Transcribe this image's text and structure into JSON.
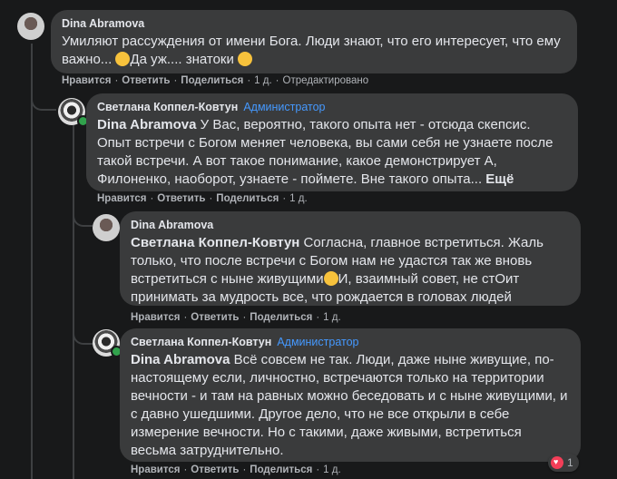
{
  "comments": [
    {
      "author": "Dina Abramova",
      "badge": "",
      "mention": "",
      "text": "Умиляют рассуждения от имени Бога. Люди знают, что его интересует, что ему важно...",
      "text2": "Да уж.... знатоки",
      "more": "",
      "actions": {
        "like": "Нравится",
        "reply": "Ответить",
        "share": "Поделиться",
        "time": "1 д.",
        "edited": "Отредактировано"
      }
    },
    {
      "author": "Светлана Коппел-Ковтун",
      "badge": "Администратор",
      "mention": "Dina Abramova",
      "text": " У Вас, вероятно, такого опыта нет - отсюда скепсис. Опыт встречи с Богом меняет человека, вы сами себя не узнаете после такой встречи. А вот такое понимание, какое демонстрирует А, Филоненко, наоборот, узнаете - поймете. Вне такого опыта...",
      "more": "Ещё",
      "actions": {
        "like": "Нравится",
        "reply": "Ответить",
        "share": "Поделиться",
        "time": "1 д."
      }
    },
    {
      "author": "Dina Abramova",
      "badge": "",
      "mention": "Светлана Коппел-Ковтун",
      "text": " Согласна, главное встретиться. Жаль только, что после встречи с Богом нам не удастся так же вновь встретиться с ныне живущими",
      "text2": "И, взаимный совет, не стОит принимать за мудрость все, что рождается в головах людей",
      "actions": {
        "like": "Нравится",
        "reply": "Ответить",
        "share": "Поделиться",
        "time": "1 д."
      }
    },
    {
      "author": "Светлана Коппел-Ковтун",
      "badge": "Администратор",
      "mention": "Dina Abramova",
      "text": " Всё совсем не так. Люди, даже ныне живущие, по-настоящему если, личностно, встречаются только на территории вечности - и там на равных можно беседовать и с ныне живущими, и с давно ушедшими. Другое дело, что не все открыли в себе измерение вечности. Но с такими, даже живыми, встретиться весьма затруднительно.",
      "reaction_count": "1",
      "actions": {
        "like": "Нравится",
        "reply": "Ответить",
        "share": "Поделиться",
        "time": "1 д."
      }
    }
  ],
  "colors": {
    "background": "#18191a",
    "bubble": "#3a3b3c",
    "admin_badge": "#4599ff",
    "online": "#31a24c"
  }
}
